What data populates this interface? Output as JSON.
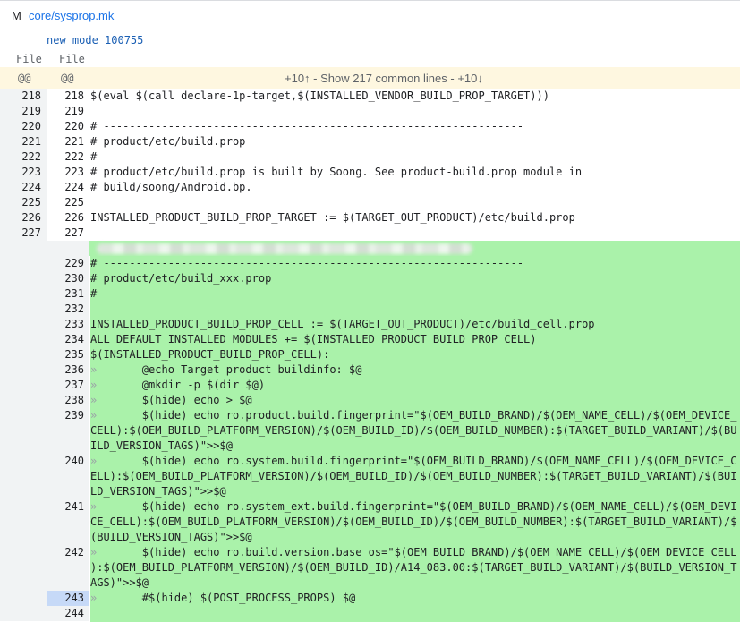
{
  "file": {
    "status": "M",
    "path": "core/sysprop.mk",
    "mode_text": "new mode 100755"
  },
  "columns": {
    "left": "File",
    "right": "File"
  },
  "context": {
    "at_left": "@@",
    "at_right": "@@",
    "expand_up": "+10↑",
    "sep1": " - ",
    "show_common": "Show 217 common lines",
    "sep2": " - ",
    "expand_down": "+10↓"
  },
  "lines": [
    {
      "left": "218",
      "right": "218",
      "type": "ctx",
      "text": "$(eval $(call declare-1p-target,$(INSTALLED_VENDOR_BUILD_PROP_TARGET)))"
    },
    {
      "left": "219",
      "right": "219",
      "type": "ctx",
      "text": ""
    },
    {
      "left": "220",
      "right": "220",
      "type": "ctx",
      "text": "# -----------------------------------------------------------------"
    },
    {
      "left": "221",
      "right": "221",
      "type": "ctx",
      "text": "# product/etc/build.prop"
    },
    {
      "left": "222",
      "right": "222",
      "type": "ctx",
      "text": "#"
    },
    {
      "left": "223",
      "right": "223",
      "type": "ctx",
      "text": "# product/etc/build.prop is built by Soong. See product-build.prop module in"
    },
    {
      "left": "224",
      "right": "224",
      "type": "ctx",
      "text": "# build/soong/Android.bp."
    },
    {
      "left": "225",
      "right": "225",
      "type": "ctx",
      "text": ""
    },
    {
      "left": "226",
      "right": "226",
      "type": "ctx",
      "text": "INSTALLED_PRODUCT_BUILD_PROP_TARGET := $(TARGET_OUT_PRODUCT)/etc/build.prop"
    },
    {
      "left": "227",
      "right": "227",
      "type": "ctx",
      "text": ""
    },
    {
      "left": "",
      "right": "",
      "type": "blur",
      "text": ""
    },
    {
      "left": "",
      "right": "229",
      "type": "add",
      "text": "# -----------------------------------------------------------------"
    },
    {
      "left": "",
      "right": "230",
      "type": "add",
      "text": "# product/etc/build_xxx.prop"
    },
    {
      "left": "",
      "right": "231",
      "type": "add",
      "text": "#"
    },
    {
      "left": "",
      "right": "232",
      "type": "add",
      "text": ""
    },
    {
      "left": "",
      "right": "233",
      "type": "add",
      "text": "INSTALLED_PRODUCT_BUILD_PROP_CELL := $(TARGET_OUT_PRODUCT)/etc/build_cell.prop"
    },
    {
      "left": "",
      "right": "234",
      "type": "add",
      "text": "ALL_DEFAULT_INSTALLED_MODULES += $(INSTALLED_PRODUCT_BUILD_PROP_CELL)"
    },
    {
      "left": "",
      "right": "235",
      "type": "add",
      "text": "$(INSTALLED_PRODUCT_BUILD_PROP_CELL):"
    },
    {
      "left": "",
      "right": "236",
      "type": "add",
      "tab": "»",
      "text": "       @echo Target product buildinfo: $@"
    },
    {
      "left": "",
      "right": "237",
      "type": "add",
      "tab": "»",
      "text": "       @mkdir -p $(dir $@)"
    },
    {
      "left": "",
      "right": "238",
      "type": "add",
      "tab": "»",
      "text": "       $(hide) echo > $@"
    },
    {
      "left": "",
      "right": "239",
      "type": "add",
      "tab": "»",
      "text": "       $(hide) echo ro.product.build.fingerprint=\"$(OEM_BUILD_BRAND)/$(OEM_NAME_CELL)/$(OEM_DEVICE_"
    },
    {
      "left": "",
      "right": "",
      "type": "add",
      "text": "CELL):$(OEM_BUILD_PLATFORM_VERSION)/$(OEM_BUILD_ID)/$(OEM_BUILD_NUMBER):$(TARGET_BUILD_VARIANT)/$(BU"
    },
    {
      "left": "",
      "right": "",
      "type": "add",
      "text": "ILD_VERSION_TAGS)\">>$@"
    },
    {
      "left": "",
      "right": "240",
      "type": "add",
      "tab": "»",
      "text": "       $(hide) echo ro.system.build.fingerprint=\"$(OEM_BUILD_BRAND)/$(OEM_NAME_CELL)/$(OEM_DEVICE_C"
    },
    {
      "left": "",
      "right": "",
      "type": "add",
      "text": "ELL):$(OEM_BUILD_PLATFORM_VERSION)/$(OEM_BUILD_ID)/$(OEM_BUILD_NUMBER):$(TARGET_BUILD_VARIANT)/$(BUI"
    },
    {
      "left": "",
      "right": "",
      "type": "add",
      "text": "LD_VERSION_TAGS)\">>$@"
    },
    {
      "left": "",
      "right": "241",
      "type": "add",
      "tab": "»",
      "text": "       $(hide) echo ro.system_ext.build.fingerprint=\"$(OEM_BUILD_BRAND)/$(OEM_NAME_CELL)/$(OEM_DEVI"
    },
    {
      "left": "",
      "right": "",
      "type": "add",
      "text": "CE_CELL):$(OEM_BUILD_PLATFORM_VERSION)/$(OEM_BUILD_ID)/$(OEM_BUILD_NUMBER):$(TARGET_BUILD_VARIANT)/$"
    },
    {
      "left": "",
      "right": "",
      "type": "add",
      "text": "(BUILD_VERSION_TAGS)\">>$@"
    },
    {
      "left": "",
      "right": "242",
      "type": "add",
      "tab": "»",
      "text": "       $(hide) echo ro.build.version.base_os=\"$(OEM_BUILD_BRAND)/$(OEM_NAME_CELL)/$(OEM_DEVICE_CELL"
    },
    {
      "left": "",
      "right": "",
      "type": "add",
      "text": "):$(OEM_BUILD_PLATFORM_VERSION)/$(OEM_BUILD_ID)/A14_083.00:$(TARGET_BUILD_VARIANT)/$(BUILD_VERSION_T"
    },
    {
      "left": "",
      "right": "",
      "type": "add",
      "text": "AGS)\">>$@"
    },
    {
      "left": "",
      "right": "243",
      "type": "add",
      "selected": true,
      "tab": "»",
      "text": "       #$(hide) $(POST_PROCESS_PROPS) $@"
    },
    {
      "left": "",
      "right": "244",
      "type": "add",
      "text": ""
    }
  ]
}
